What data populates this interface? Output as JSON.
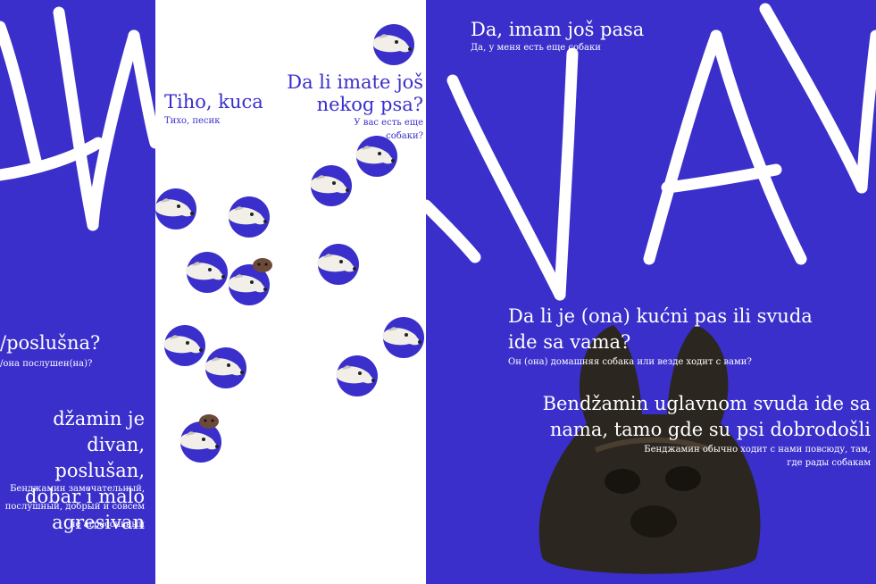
{
  "colors": {
    "blue": "#3A2FCB",
    "white": "#FFFFFF",
    "dark": "#2A2A22"
  },
  "left": {
    "question": "/poslušna?",
    "question_ru": "/она послушен(на)?",
    "answer": "džamin je divan, poslušan, dobar i malo agresivan",
    "answer_ru": "Бенджамин замечательный, послушный, добрый и совсем не агрессивный"
  },
  "middle": {
    "title": "Tiho, kuca",
    "title_ru": "Тихо, песик",
    "question": "Da li imate još nekog psa?",
    "question_ru": "У вас есть еще собаки?"
  },
  "right": {
    "title": "Da, imam još pasa",
    "title_ru": "Да, у меня есть еще собаки",
    "question": "Da li je (ona) kućni pas ili svuda ide sa vama?",
    "question_ru": "Он (она) домашняя собака или везде ходит с вами?",
    "answer": "Bendžamin uglavnom svuda ide sa nama, tamo gde su psi dobrodošli",
    "answer_ru": "Бенджамин обычно ходит с нами повсюду, там, где рады собакам"
  },
  "icons": [
    "handwritten-av-lettering",
    "greyhound-dog-sticker",
    "puppy-sticker",
    "french-bulldog-photo"
  ]
}
